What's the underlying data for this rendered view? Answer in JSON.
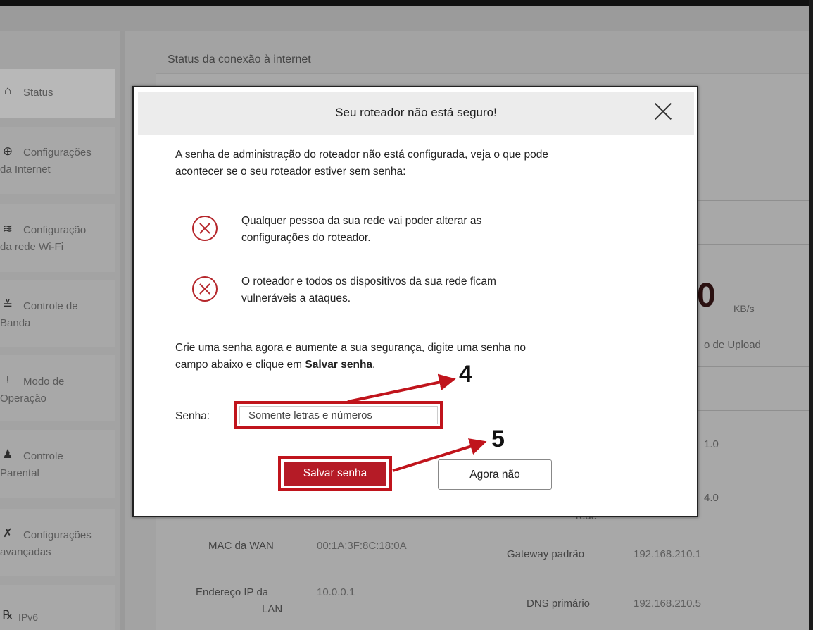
{
  "sidebar": {
    "items": [
      {
        "icon": "router-icon",
        "glyph": "⌂",
        "line1": "Status",
        "line2": ""
      },
      {
        "icon": "globe-icon",
        "glyph": "⊕",
        "line1": "Configurações",
        "line2": "da Internet"
      },
      {
        "icon": "wifi-icon",
        "glyph": "≋",
        "line1": "Configuração",
        "line2": "da rede Wi-Fi"
      },
      {
        "icon": "bandwidth-icon",
        "glyph": "≚",
        "line1": "Controle de",
        "line2": "Banda"
      },
      {
        "icon": "antenna-icon",
        "glyph": "ᵎ",
        "line1": "Modo de",
        "line2": "Operação"
      },
      {
        "icon": "parental-icon",
        "glyph": "♟",
        "line1": "Controle",
        "line2": "Parental"
      },
      {
        "icon": "tools-icon",
        "glyph": "✗",
        "line1": "Configurações",
        "line2": "avançadas"
      },
      {
        "icon": "ipv6-icon",
        "glyph": "℞",
        "line1": "IPv6",
        "line2": ""
      }
    ]
  },
  "main": {
    "title": "Status da conexão à internet",
    "speed_unit": "KB/s",
    "upload_label": "o de Upload",
    "fields": {
      "wan_mac_label": "MAC da WAN",
      "wan_mac_value": "00:1A:3F:8C:18:0A",
      "lan_ip_label_1": "Endereço IP da",
      "lan_ip_label_2": "LAN",
      "lan_ip_value": "10.0.0.1",
      "gateway_label": "Gateway padrão",
      "gateway_value": "192.168.210.1",
      "dns_label": "DNS primário",
      "dns_value": "192.168.210.5",
      "partial_1": "1.0",
      "partial_2": "4.0",
      "partial_3": "rede"
    }
  },
  "dialog": {
    "title": "Seu roteador não está seguro!",
    "intro_line1": "A senha de administração do roteador não está configurada, veja o que pode",
    "intro_line2": "acontecer se o seu roteador estiver sem senha:",
    "warnings": [
      {
        "line1": "Qualquer pessoa da sua rede vai poder alterar as",
        "line2": "configurações do roteador."
      },
      {
        "line1": "O roteador e todos os dispositivos da sua rede ficam",
        "line2": "vulneráveis a ataques."
      }
    ],
    "cta_line1": "Crie uma senha agora e aumente a sua segurança, digite uma senha no",
    "cta_line2_pre": "campo abaixo e clique em ",
    "cta_line2_bold": "Salvar senha",
    "cta_line2_post": ".",
    "password_label": "Senha:",
    "password_placeholder": "Somente letras e números",
    "password_value": "",
    "save_label": "Salvar senha",
    "later_label": "Agora não"
  },
  "annotations": {
    "step_password": "4",
    "step_save": "5"
  },
  "colors": {
    "accent": "#b51b26",
    "highlight": "#c0141c"
  }
}
